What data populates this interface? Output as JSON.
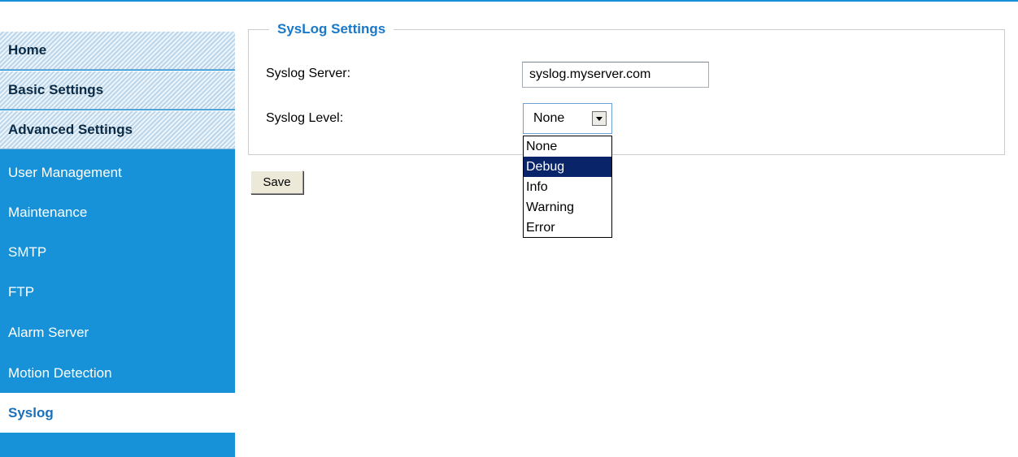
{
  "sidebar": {
    "sections": [
      "Home",
      "Basic Settings",
      "Advanced Settings"
    ],
    "items": [
      "User Management",
      "Maintenance",
      "SMTP",
      "FTP",
      "Alarm Server",
      "Motion Detection",
      "Syslog"
    ],
    "active_item": "Syslog"
  },
  "syslog": {
    "legend": "SysLog Settings",
    "server_label": "Syslog Server:",
    "server_value": "syslog.myserver.com",
    "level_label": "Syslog Level:",
    "level_value": "None",
    "level_options": [
      "None",
      "Debug",
      "Info",
      "Warning",
      "Error"
    ],
    "highlighted_option": "Debug",
    "save_label": "Save"
  },
  "colors": {
    "sidebar_bg": "#1791d8",
    "accent": "#1a78c8",
    "highlight": "#0a246a"
  }
}
